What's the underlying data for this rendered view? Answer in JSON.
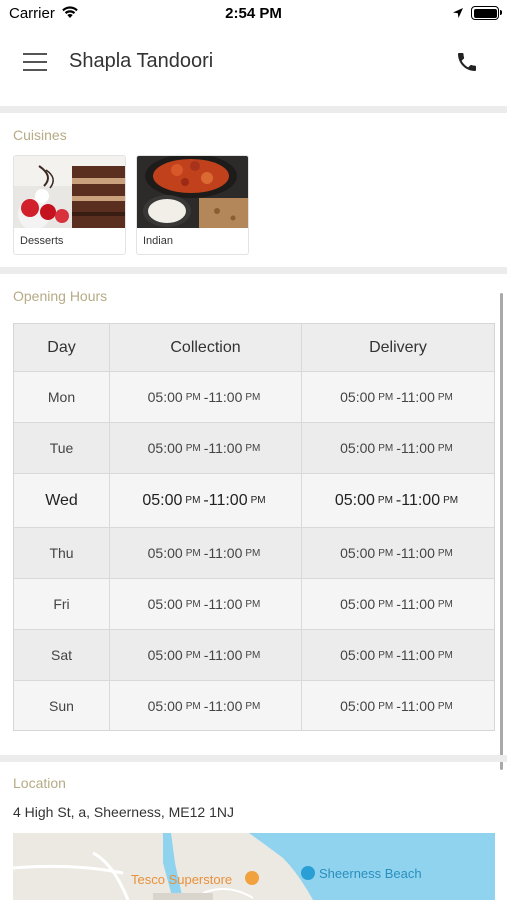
{
  "status_bar": {
    "carrier": "Carrier",
    "time": "2:54 PM"
  },
  "header": {
    "title": "Shapla Tandoori"
  },
  "cuisines": {
    "title": "Cuisines",
    "items": [
      {
        "label": "Desserts"
      },
      {
        "label": "Indian"
      }
    ]
  },
  "opening_hours": {
    "title": "Opening Hours",
    "headers": {
      "day": "Day",
      "collection": "Collection",
      "delivery": "Delivery"
    },
    "rows": [
      {
        "day": "Mon",
        "collection": {
          "start": "05:00",
          "start_period": "PM",
          "end": "11:00",
          "end_period": "PM"
        },
        "delivery": {
          "start": "05:00",
          "start_period": "PM",
          "end": "11:00",
          "end_period": "PM"
        }
      },
      {
        "day": "Tue",
        "collection": {
          "start": "05:00",
          "start_period": "PM",
          "end": "11:00",
          "end_period": "PM"
        },
        "delivery": {
          "start": "05:00",
          "start_period": "PM",
          "end": "11:00",
          "end_period": "PM"
        }
      },
      {
        "day": "Wed",
        "collection": {
          "start": "05:00",
          "start_period": "PM",
          "end": "11:00",
          "end_period": "PM"
        },
        "delivery": {
          "start": "05:00",
          "start_period": "PM",
          "end": "11:00",
          "end_period": "PM"
        }
      },
      {
        "day": "Thu",
        "collection": {
          "start": "05:00",
          "start_period": "PM",
          "end": "11:00",
          "end_period": "PM"
        },
        "delivery": {
          "start": "05:00",
          "start_period": "PM",
          "end": "11:00",
          "end_period": "PM"
        }
      },
      {
        "day": "Fri",
        "collection": {
          "start": "05:00",
          "start_period": "PM",
          "end": "11:00",
          "end_period": "PM"
        },
        "delivery": {
          "start": "05:00",
          "start_period": "PM",
          "end": "11:00",
          "end_period": "PM"
        }
      },
      {
        "day": "Sat",
        "collection": {
          "start": "05:00",
          "start_period": "PM",
          "end": "11:00",
          "end_period": "PM"
        },
        "delivery": {
          "start": "05:00",
          "start_period": "PM",
          "end": "11:00",
          "end_period": "PM"
        }
      },
      {
        "day": "Sun",
        "collection": {
          "start": "05:00",
          "start_period": "PM",
          "end": "11:00",
          "end_period": "PM"
        },
        "delivery": {
          "start": "05:00",
          "start_period": "PM",
          "end": "11:00",
          "end_period": "PM"
        }
      }
    ],
    "highlighted_day": "Wed"
  },
  "location": {
    "title": "Location",
    "address": "4 High St, a, Sheerness, ME12 1NJ",
    "map": {
      "labels": {
        "store": "Tesco Superstore",
        "beach": "Sheerness Beach"
      },
      "colors": {
        "land": "#ece9e3",
        "water": "#8fd3ee",
        "store_label": "#e8913a",
        "beach_label": "#2a8fbf"
      }
    }
  },
  "icons": {
    "menu": "hamburger-menu-icon",
    "phone": "phone-icon",
    "wifi": "wifi-icon",
    "location": "location-arrow-icon",
    "battery": "battery-icon"
  },
  "colors": {
    "section_title": "#b6ab86",
    "divider": "#ececec",
    "table_border": "#d6d6d6"
  },
  "battery_level": 1.0
}
